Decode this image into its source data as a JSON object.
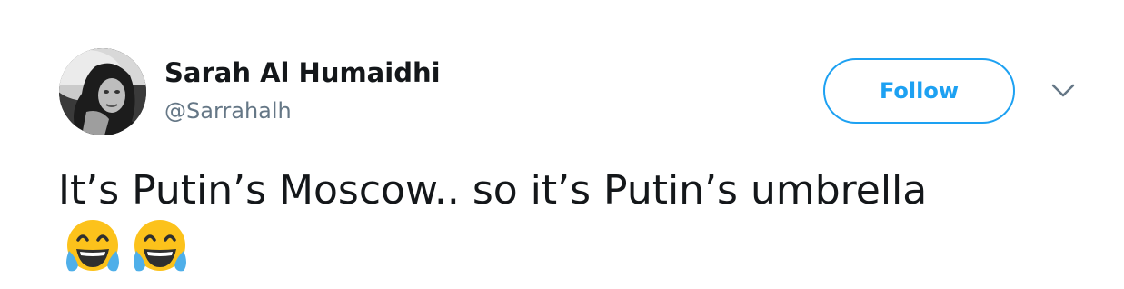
{
  "author": {
    "display_name": "Sarah Al Humaidhi",
    "handle": "@Sarrahalh"
  },
  "actions": {
    "follow_label": "Follow",
    "menu_icon": "chevron-down-icon"
  },
  "tweet": {
    "text": "It’s Putin’s Moscow.. so it’s Putin’s umbrella",
    "emojis": [
      "face-with-tears-of-joy",
      "face-with-tears-of-joy"
    ]
  },
  "colors": {
    "accent": "#1da1f2",
    "text": "#14171a",
    "secondary_text": "#657786",
    "chevron": "#657786",
    "emoji_face": "#fcc21b",
    "emoji_tears": "#4fafe9"
  }
}
